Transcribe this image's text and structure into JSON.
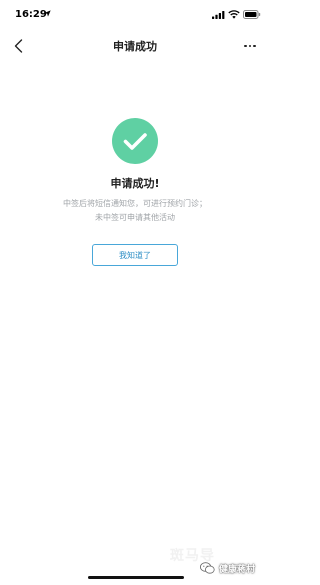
{
  "status_bar": {
    "time": "16:29",
    "icons": [
      "location-arrow-icon",
      "signal-icon",
      "wifi-icon",
      "battery-icon"
    ]
  },
  "nav": {
    "back_icon": "chevron-left-icon",
    "title": "申请成功",
    "more_icon": "more-dots-icon"
  },
  "result": {
    "icon": "check-circle-icon",
    "icon_color": "#5fd0a3",
    "title": "申请成功!",
    "description_line1": "中签后将短信通知您，可进行预约门诊；",
    "description_line2": "未中签可申请其他活动"
  },
  "actions": {
    "ok_label": "我知道了",
    "accent": "#49a7d9"
  },
  "watermark": {
    "text": "斑马导",
    "wechat_icon": "wechat-icon",
    "account": "健康蒋村"
  }
}
